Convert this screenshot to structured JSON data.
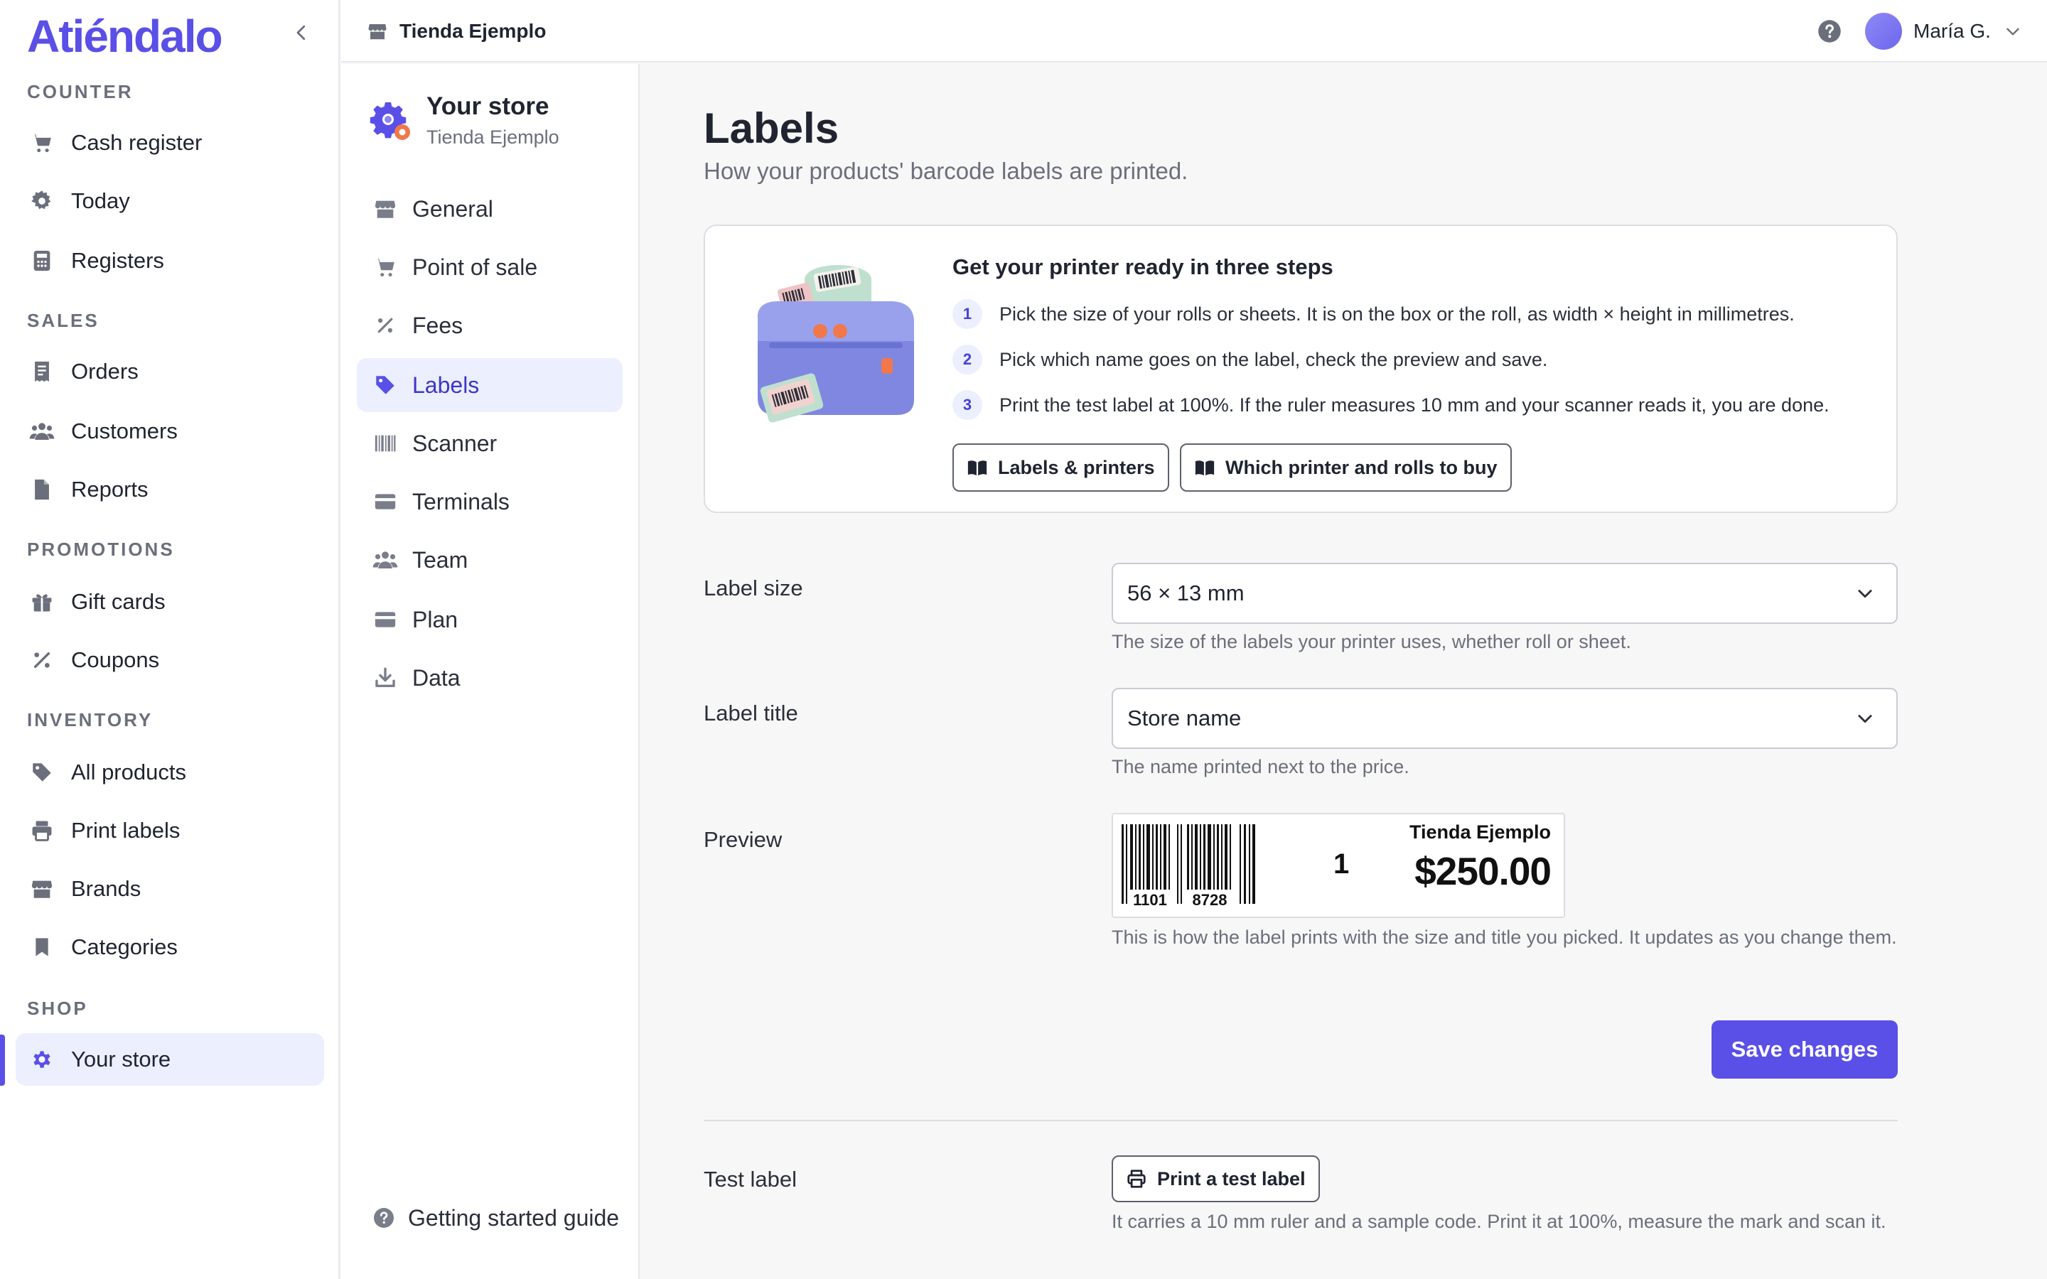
{
  "app": {
    "logo": "Atiéndalo"
  },
  "sidebar": {
    "sections": [
      {
        "title": "COUNTER",
        "items": [
          {
            "label": "Cash register",
            "icon": "cart-icon"
          },
          {
            "label": "Today",
            "icon": "gear-sun-icon"
          },
          {
            "label": "Registers",
            "icon": "calculator-icon"
          }
        ]
      },
      {
        "title": "SALES",
        "items": [
          {
            "label": "Orders",
            "icon": "receipt-icon"
          },
          {
            "label": "Customers",
            "icon": "users-icon"
          },
          {
            "label": "Reports",
            "icon": "document-icon"
          }
        ]
      },
      {
        "title": "PROMOTIONS",
        "items": [
          {
            "label": "Gift cards",
            "icon": "gift-icon"
          },
          {
            "label": "Coupons",
            "icon": "percent-icon"
          }
        ]
      },
      {
        "title": "INVENTORY",
        "items": [
          {
            "label": "All products",
            "icon": "tag-icon"
          },
          {
            "label": "Print labels",
            "icon": "printer-icon"
          },
          {
            "label": "Brands",
            "icon": "store-icon"
          },
          {
            "label": "Categories",
            "icon": "bookmark-icon"
          }
        ]
      },
      {
        "title": "SHOP",
        "items": [
          {
            "label": "Your store",
            "icon": "gear-icon",
            "active": true
          }
        ]
      }
    ]
  },
  "topbar": {
    "store_name": "Tienda Ejemplo",
    "user_name": "María G."
  },
  "settings": {
    "title": "Your store",
    "subtitle": "Tienda Ejemplo",
    "items": [
      {
        "label": "General",
        "icon": "store-icon"
      },
      {
        "label": "Point of sale",
        "icon": "cart-icon"
      },
      {
        "label": "Fees",
        "icon": "percent-icon"
      },
      {
        "label": "Labels",
        "icon": "tag-icon",
        "active": true
      },
      {
        "label": "Scanner",
        "icon": "barcode-icon"
      },
      {
        "label": "Terminals",
        "icon": "card-icon"
      },
      {
        "label": "Team",
        "icon": "users-icon"
      },
      {
        "label": "Plan",
        "icon": "card-icon"
      },
      {
        "label": "Data",
        "icon": "download-icon"
      }
    ],
    "guide_label": "Getting started guide"
  },
  "main": {
    "title": "Labels",
    "subtitle": "How your products' barcode labels are printed.",
    "steps": {
      "title": "Get your printer ready in three steps",
      "items": [
        {
          "num": "1",
          "text": "Pick the size of your rolls or sheets. It is on the box or the roll, as width × height in millimetres."
        },
        {
          "num": "2",
          "text": "Pick which name goes on the label, check the preview and save."
        },
        {
          "num": "3",
          "text": "Print the test label at 100%. If the ruler measures 10 mm and your scanner reads it, you are done."
        }
      ],
      "buttons": [
        {
          "label": "Labels & printers"
        },
        {
          "label": "Which printer and rolls to buy"
        }
      ]
    },
    "label_size": {
      "label": "Label size",
      "value": "56 × 13 mm",
      "hint": "The size of the labels your printer uses, whether roll or sheet."
    },
    "label_title": {
      "label": "Label title",
      "value": "Store name",
      "hint": "The name printed next to the price."
    },
    "preview": {
      "label": "Preview",
      "barcode_left": "1101",
      "barcode_right": "8728",
      "quantity": "1",
      "store": "Tienda Ejemplo",
      "price": "$250.00",
      "hint": "This is how the label prints with the size and title you picked. It updates as you change them."
    },
    "save_label": "Save changes",
    "test": {
      "label": "Test label",
      "button": "Print a test label",
      "hint": "It carries a 10 mm ruler and a sample code. Print it at 100%, measure the mark and scan it."
    }
  },
  "colors": {
    "accent": "#5a4fe6",
    "active_bg": "#eceffd"
  }
}
